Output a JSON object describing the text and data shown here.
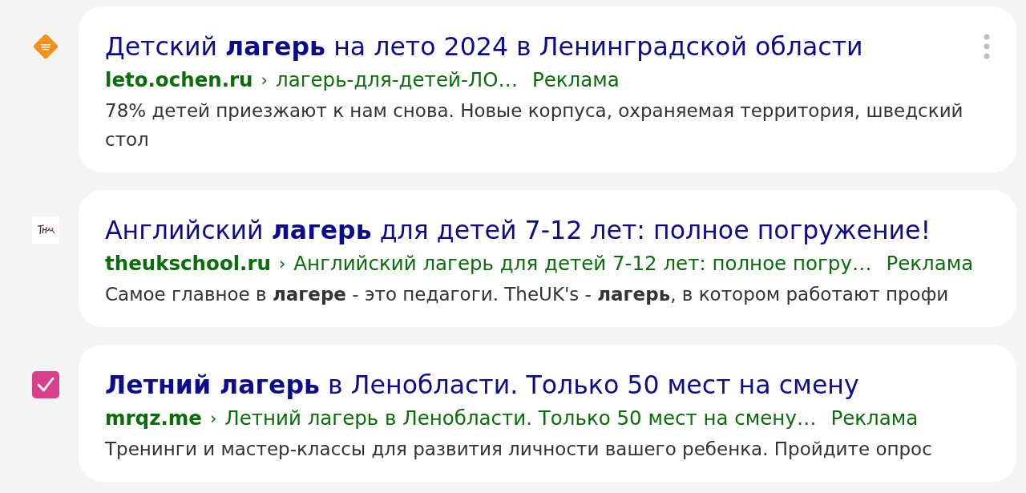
{
  "ads": [
    {
      "icon": {
        "kind": "diamond"
      },
      "title": "Детский **лагерь** на лето 2024 в Ленинградской области",
      "domain": "leto.ochen.ru",
      "separator": "›",
      "path": "лагерь-для-детей-ЛО…",
      "label": "Реклама",
      "snippet": "78% детей приезжают к нам снова. Новые корпуса, охраняемая территория, шведский стол",
      "menu": true
    },
    {
      "icon": {
        "kind": "text_logo"
      },
      "title": "Английский **лагерь** для детей 7-12 лет: полное погружение!",
      "domain": "theukschool.ru",
      "separator": "›",
      "path": "Английский лагерь для детей 7-12 лет: полное погру…",
      "label": "Реклама",
      "snippet": "Самое главное в **лагере** - это педагоги. TheUK's - **лагерь**, в котором работают профи",
      "menu": false
    },
    {
      "icon": {
        "kind": "checkbox"
      },
      "title": "**Летний лагерь** в Ленобласти. Только 50 мест на смену",
      "domain": "mrqz.me",
      "separator": "›",
      "path": "Летний лагерь в Ленобласти. Только 50 мест на смену…",
      "label": "Реклама",
      "snippet": "Тренинги и мастер-классы для развития личности вашего ребенка. Пройдите опрос",
      "menu": false
    }
  ]
}
